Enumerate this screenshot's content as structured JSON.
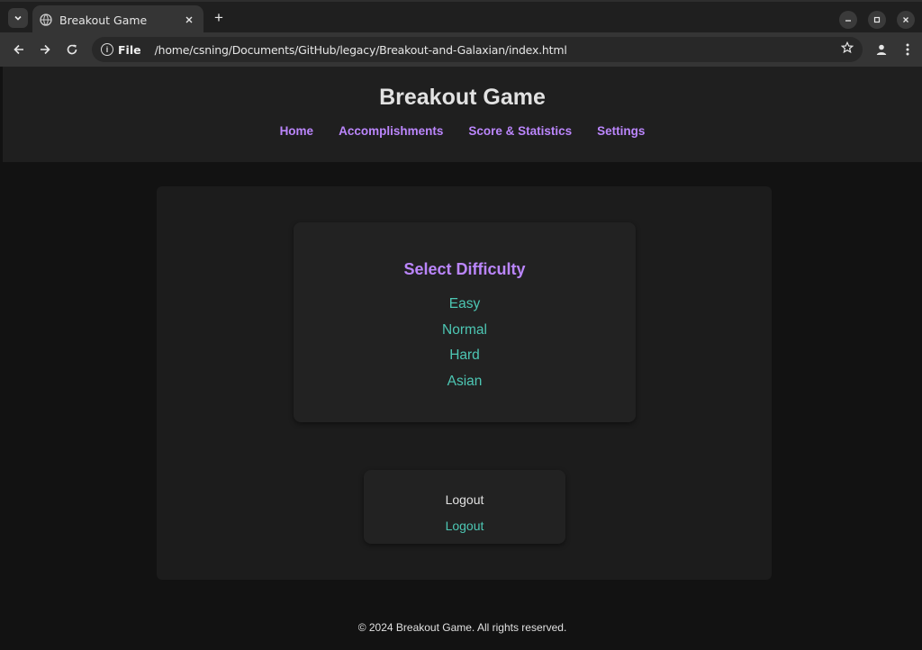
{
  "browser": {
    "tab_title": "Breakout Game",
    "new_tab_symbol": "+",
    "omnibox": {
      "scheme_label": "File",
      "url": "/home/csning/Documents/GitHub/legacy/Breakout-and-Galaxian/index.html"
    },
    "icons": [
      "tab-search-icon",
      "globe-icon",
      "close-icon",
      "plus-icon",
      "minimize-icon",
      "maximize-icon",
      "close-window-icon",
      "back-arrow-icon",
      "forward-arrow-icon",
      "reload-icon",
      "info-icon",
      "star-icon",
      "profile-icon",
      "kebab-menu-icon"
    ]
  },
  "header": {
    "title": "Breakout Game",
    "nav": [
      {
        "label": "Home"
      },
      {
        "label": "Accomplishments"
      },
      {
        "label": "Score & Statistics"
      },
      {
        "label": "Settings"
      }
    ]
  },
  "difficulty": {
    "title": "Select Difficulty",
    "options": [
      {
        "label": "Easy"
      },
      {
        "label": "Normal"
      },
      {
        "label": "Hard"
      },
      {
        "label": "Asian"
      }
    ]
  },
  "logout": {
    "heading": "Logout",
    "link": "Logout"
  },
  "footer": {
    "text": "© 2024 Breakout Game. All rights reserved."
  },
  "colors": {
    "accent_purple": "#bb86fc",
    "accent_teal": "#4dc7b4",
    "background": "#121212",
    "surface": "#1f1f1f"
  }
}
